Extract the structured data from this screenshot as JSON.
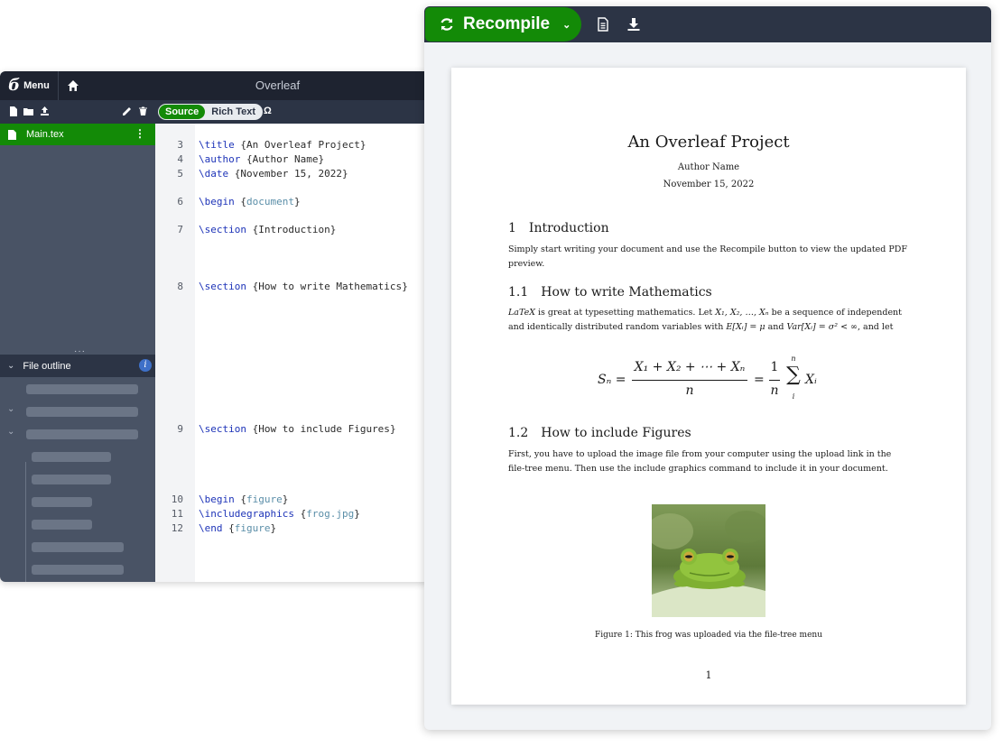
{
  "editor": {
    "app_title": "Overleaf",
    "menu_label": "Menu",
    "logo_glyph": "б",
    "toolbar": {
      "source_label": "Source",
      "rich_text_label": "Rich Text",
      "symbol_label": "Ω"
    },
    "file": {
      "name": "Main.tex",
      "more_glyph": "⋮"
    },
    "outline": {
      "label": "File outline",
      "info_glyph": "i",
      "expand_glyph": "⌄",
      "handle": "···"
    },
    "code_lines": [
      {
        "num": "3",
        "cmd": "\\title",
        "open": " {",
        "arg": "An Overleaf Project",
        "close": "}"
      },
      {
        "num": "4",
        "cmd": "\\author",
        "open": " {",
        "arg": "Author Name",
        "close": "}"
      },
      {
        "num": "5",
        "cmd": "\\date",
        "open": " {",
        "arg": "November 15, 2022",
        "close": "}"
      },
      {
        "num": "6",
        "cmd": "\\begin",
        "open": " {",
        "arg": "document",
        "close": "}"
      },
      {
        "num": "7",
        "cmd": "\\section",
        "open": " {",
        "arg": "Introduction",
        "close": "}"
      },
      {
        "num": "8",
        "cmd": "\\section",
        "open": " {",
        "arg": "How to write Mathematics",
        "close": "}"
      },
      {
        "num": "9",
        "cmd": "\\section",
        "open": " {",
        "arg": "How to include Figures",
        "close": "}"
      },
      {
        "num": "10",
        "cmd": "\\begin",
        "open": " {",
        "arg": "figure",
        "close": "}"
      },
      {
        "num": "11",
        "cmd": "\\includegraphics",
        "open": " {",
        "arg": "frog.jpg",
        "close": "}"
      },
      {
        "num": "12",
        "cmd": "\\end",
        "open": " {",
        "arg": "figure",
        "close": "}"
      }
    ]
  },
  "preview": {
    "recompile_label": "Recompile",
    "caret_glyph": "⌄",
    "page": {
      "title": "An Overleaf Project",
      "author": "Author Name",
      "date": "November 15, 2022",
      "sec1_num": "1",
      "sec1_title": "Introduction",
      "sec1_text": "Simply start writing your document and use the Recompile button to view the updated PDF preview.",
      "sec11_num": "1.1",
      "sec11_title": "How to write Mathematics",
      "sec11_text_a": " is great at typesetting mathematics. Let ",
      "sec11_text_b": " be a sequence of independent and identically distributed random variables with ",
      "sec11_text_c": " and ",
      "sec11_text_d": ", and let",
      "latex_logo": "LaTeX",
      "vars": "X₁, X₂, …, Xₙ",
      "mean": "E[Xᵢ] = μ",
      "variance": "Var[Xᵢ] = σ² < ∞",
      "sec12_num": "1.2",
      "sec12_title": "How to include Figures",
      "sec12_text": "First, you have to upload the image file from your computer using the upload link in the file-tree menu. Then use the include graphics command to include it in your document.",
      "equation": {
        "lhs": "Sₙ =",
        "numerator": "X₁ + X₂ + ⋯ + Xₙ",
        "denominator": "n",
        "mid": "=",
        "one": "1",
        "n_den": "n",
        "sum_top": "n",
        "sum_sign": "∑",
        "sum_bottom": "i",
        "term": "Xᵢ"
      },
      "caption": "Figure 1:  This frog was uploaded via the file-tree menu",
      "page_number": "1"
    }
  }
}
